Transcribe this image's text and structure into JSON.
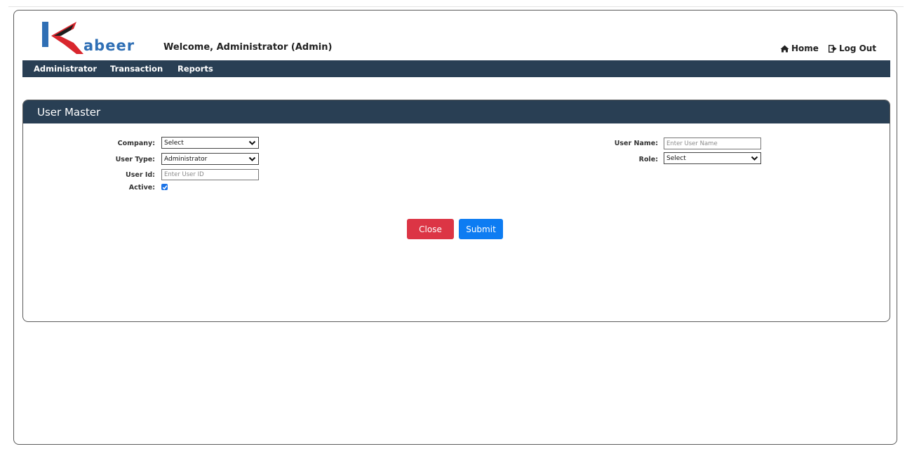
{
  "brand": {
    "logo_text": "abeer",
    "colors": {
      "primary": "#2f6fb5",
      "accent": "#d9262d",
      "dark": "#1d1d1d"
    }
  },
  "header": {
    "welcome": "Welcome, Administrator (Admin)",
    "links": [
      {
        "label": "Home",
        "icon": "home-icon"
      },
      {
        "label": "Log Out",
        "icon": "logout-icon"
      }
    ]
  },
  "nav": {
    "items": [
      "Administrator",
      "Transaction",
      "Reports"
    ],
    "bg": "#293f54"
  },
  "panel": {
    "title": "User Master"
  },
  "form": {
    "company": {
      "label": "Company:",
      "value": "Select"
    },
    "user_type": {
      "label": "User Type:",
      "value": "Administrator"
    },
    "user_id": {
      "label": "User Id:",
      "placeholder": "Enter User ID"
    },
    "active": {
      "label": "Active:",
      "checked": true
    },
    "user_name": {
      "label": "User Name:",
      "placeholder": "Enter User Name"
    },
    "role": {
      "label": "Role:",
      "value": "Select"
    }
  },
  "buttons": {
    "close": {
      "label": "Close",
      "color": "#dc3545"
    },
    "submit": {
      "label": "Submit",
      "color": "#0d7cf2"
    }
  }
}
